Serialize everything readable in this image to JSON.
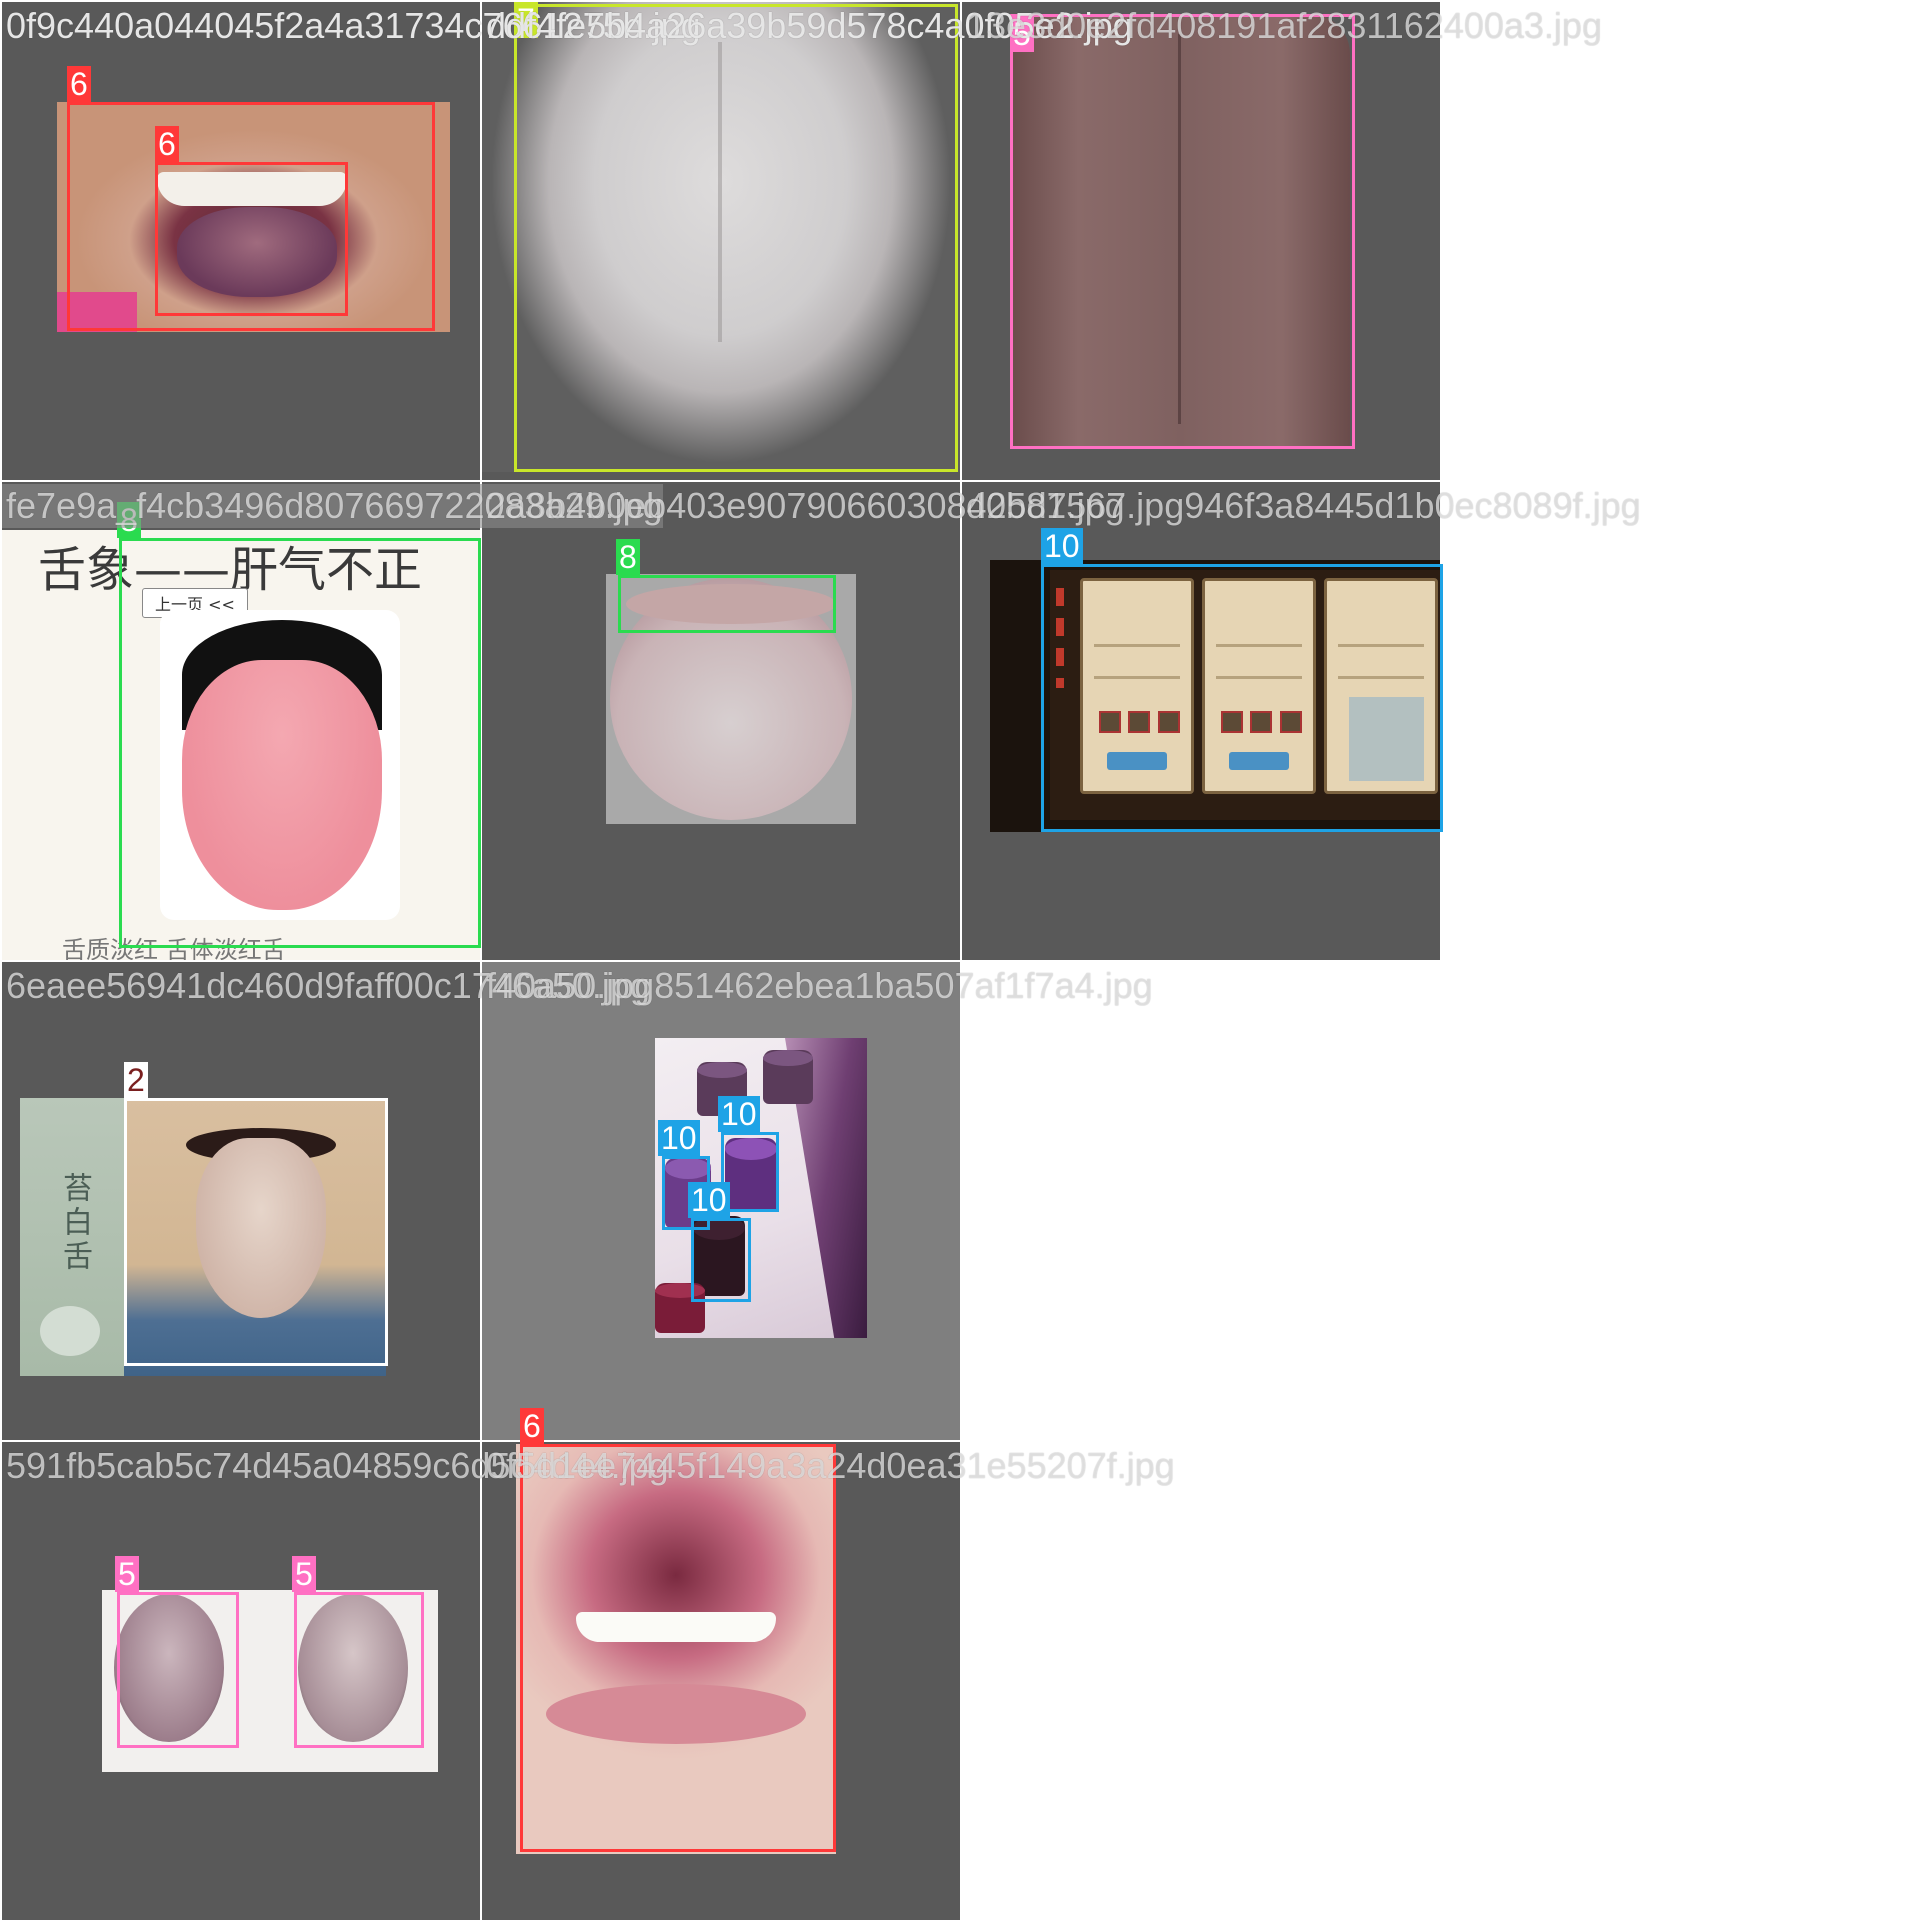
{
  "tiles": [
    {
      "filename": "0f9c440a044045f2a4a31734c7661275b.jpg",
      "boxes": [
        {
          "label": "6",
          "color": "#ff3838"
        },
        {
          "label": "6",
          "color": "#ff3838"
        }
      ]
    },
    {
      "filename": "ddf4fe5b4a26a39b59d578c4a0f05e2.jpg",
      "boxes": [
        {
          "label": "7",
          "color": "#c8e62a"
        }
      ]
    },
    {
      "filename": "13e3d0e2fd408191af2831162400a3.jpg",
      "boxes": [
        {
          "label": "5",
          "color": "#ff70c3"
        }
      ]
    },
    {
      "filename": "fe7e9a_f4cb3496d807669722083a29.jpg",
      "boxes": [
        {
          "label": "8",
          "color": "#2adb4f"
        }
      ],
      "text": {
        "heading": "舌象——肝气不正",
        "button": "上一页 <<",
        "bottom": "舌质淡红 舌体淡红舌"
      }
    },
    {
      "filename": "2a8b4b0eb403e90790660308425d7.jpg",
      "boxes": [
        {
          "label": "8",
          "color": "#2adb4f"
        }
      ]
    },
    {
      "filename": "d0b81567.jpg946f3a8445d1b0ec8089f.jpg",
      "boxes": [
        {
          "label": "10",
          "color": "#1ea3e6"
        }
      ]
    },
    {
      "filename": "6eaee56941dc460d9faff00c1746a50.jpg",
      "boxes": [
        {
          "label": "2",
          "color": "#ffffff"
        }
      ],
      "text": {
        "side_label": "苔白舌"
      }
    },
    {
      "filename": "f40a50.jpg851462ebea1ba507af1f7a4.jpg",
      "boxes": [
        {
          "label": "10",
          "color": "#1ea3e6"
        },
        {
          "label": "10",
          "color": "#1ea3e6"
        },
        {
          "label": "10",
          "color": "#1ea3e6"
        }
      ]
    },
    {
      "filename": "591fb5cab5c74d45a04859c6d5d4d44.jpg",
      "boxes": [
        {
          "label": "5",
          "color": "#ff70c3"
        },
        {
          "label": "5",
          "color": "#ff70c3"
        }
      ]
    },
    {
      "filename": "0f5d1ee7445f149a3a24d0ea31e55207f.jpg",
      "boxes": [
        {
          "label": "6",
          "color": "#ff3838"
        }
      ]
    }
  ]
}
